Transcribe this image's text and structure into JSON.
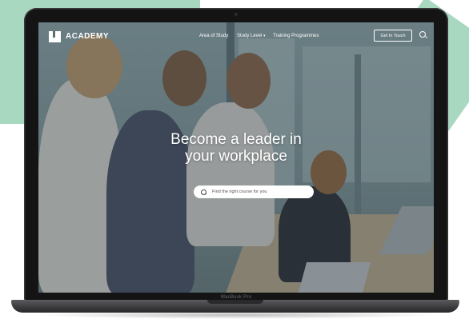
{
  "brand": {
    "name": "ACADEMY"
  },
  "nav": {
    "links": [
      {
        "label": "Area of Study"
      },
      {
        "label": "Study Level",
        "dropdown": true
      },
      {
        "label": "Training Programmes"
      }
    ],
    "cta_label": "Get In Touch",
    "search_icon": "search-icon"
  },
  "hero": {
    "title_line1": "Become a leader in",
    "title_line2": "your workplace",
    "search_placeholder": "Find the right course for you"
  },
  "device": {
    "model_label": "MacBook Pro"
  },
  "colors": {
    "accent_mint": "#a9d8c0",
    "overlay": "#0a1923"
  }
}
